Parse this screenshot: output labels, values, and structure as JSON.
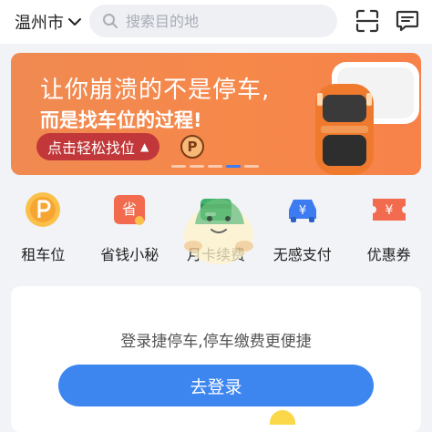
{
  "header": {
    "city": "温州市",
    "city_dropdown_icon": "chevron-down-icon",
    "search_placeholder": "搜索目的地",
    "search_icon": "search-icon",
    "scan_icon": "scan-icon",
    "message_icon": "message-icon"
  },
  "banner": {
    "line1": "让你崩溃的不是停车,",
    "line2": "而是找车位的过程!",
    "cta": "点击轻松找位",
    "cta_arrow": "▲",
    "coin_letter": "P",
    "slide_count": 5,
    "active_slide": 4
  },
  "quick_actions": [
    {
      "label": "租车位",
      "icon": "parking-coin-icon",
      "color": "#f7a531"
    },
    {
      "label": "省钱小秘",
      "icon": "savings-tag-icon",
      "color": "#f26b4f"
    },
    {
      "label": "月卡续费",
      "icon": "monthly-card-icon",
      "color": "#3fb26d"
    },
    {
      "label": "无感支付",
      "icon": "car-pay-icon",
      "color": "#3d7bf0"
    },
    {
      "label": "优惠券",
      "icon": "coupon-icon",
      "color": "#f26b4f"
    }
  ],
  "icon_glyphs": {
    "savings": "省",
    "yen": "¥"
  },
  "login_card": {
    "message": "登录捷停车,停车缴费更便捷",
    "button": "去登录"
  },
  "colors": {
    "accent": "#3d86f0",
    "banner": "#f6884a",
    "cta": "#c2383a"
  }
}
